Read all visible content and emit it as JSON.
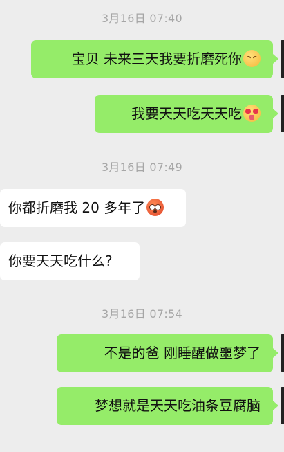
{
  "chat": {
    "groups": [
      {
        "timestamp": "3月16日 07:40",
        "messages": [
          {
            "direction": "outgoing",
            "text": "宝贝  未来三天我要折磨死你",
            "emoji": "persevering-face-emoji"
          },
          {
            "direction": "outgoing",
            "text": "我要天天吃天天吃",
            "emoji": "heart-eyes-tongue-emoji"
          }
        ]
      },
      {
        "timestamp": "3月16日 07:49",
        "messages": [
          {
            "direction": "incoming",
            "text": "你都折磨我 20 多年了",
            "emoji": "flushed-face-emoji"
          },
          {
            "direction": "incoming",
            "text": "你要天天吃什么?"
          }
        ]
      },
      {
        "timestamp": "3月16日 07:54",
        "messages": [
          {
            "direction": "outgoing",
            "text": "不是的爸  刚睡醒做噩梦了"
          },
          {
            "direction": "outgoing",
            "text": "梦想就是天天吃油条豆腐脑"
          }
        ]
      }
    ]
  },
  "colors": {
    "background": "#ededed",
    "outgoing_bubble": "#95ec69",
    "incoming_bubble": "#ffffff",
    "timestamp_text": "#a6a6a6"
  }
}
